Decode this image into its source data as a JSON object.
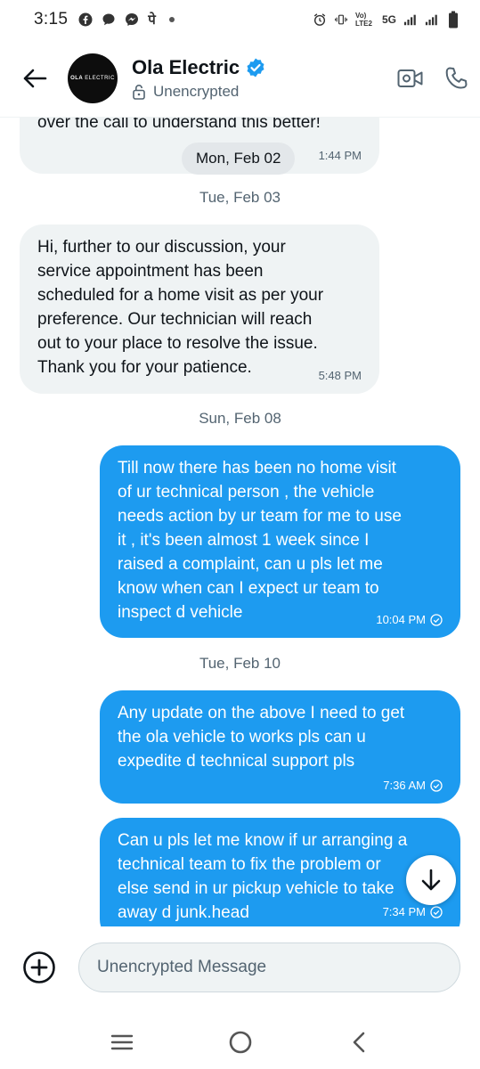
{
  "status_bar": {
    "time": "3:15",
    "indicator": "पे",
    "network": "Vo) LTE2",
    "network_gen": "5G"
  },
  "header": {
    "contact_name": "Ola Electric",
    "encryption_status": "Unencrypted",
    "avatar_text_bold": "OLA",
    "avatar_text": "ELECTRIC"
  },
  "chat": {
    "floating_date": "Mon, Feb 02",
    "messages": [
      {
        "direction": "incoming",
        "lines": [
          "over the call to understand this better!"
        ],
        "time": "1:44 PM"
      },
      {
        "direction": "incoming",
        "lines": [
          "Hi, further to our discussion, your",
          "service appointment has been",
          "scheduled for a home visit as per your",
          "preference. Our technician will reach",
          "out to your place to resolve the issue.",
          "Thank you for your patience."
        ],
        "time": "5:48 PM"
      },
      {
        "direction": "outgoing",
        "lines": [
          "Till now there has been no home visit",
          "of ur technical person , the vehicle",
          "needs action by ur team for me to use",
          "it , it's been almost 1 week since I",
          "raised a complaint, can u pls let me",
          "know when can I expect ur team to",
          "inspect d vehicle"
        ],
        "time": "10:04 PM"
      },
      {
        "direction": "outgoing",
        "lines": [
          "Any update on the above I need to get",
          "the ola vehicle to works pls can u",
          "expedite d technical support pls"
        ],
        "time": "7:36 AM"
      },
      {
        "direction": "outgoing",
        "lines": [
          "Can u pls let me know if ur arranging a",
          "technical team to fix the problem or",
          "else send in ur pickup vehicle to take",
          "away d junk.head"
        ],
        "time": "7:34 PM"
      }
    ],
    "date_separators": [
      "Tue, Feb 03",
      "Sun, Feb 08",
      "Tue, Feb 10"
    ]
  },
  "composer": {
    "placeholder": "Unencrypted Message"
  },
  "colors": {
    "accent": "#1d9bf0",
    "incoming_bubble": "#eff3f4",
    "secondary_text": "#536471"
  },
  "icons": {
    "back": "arrow-left-icon",
    "verified": "verified-badge-icon",
    "lock": "lock-icon",
    "video": "video-call-icon",
    "phone": "phone-icon",
    "read": "read-receipt-icon",
    "scroll": "arrow-down-icon",
    "add": "plus-circle-icon"
  }
}
